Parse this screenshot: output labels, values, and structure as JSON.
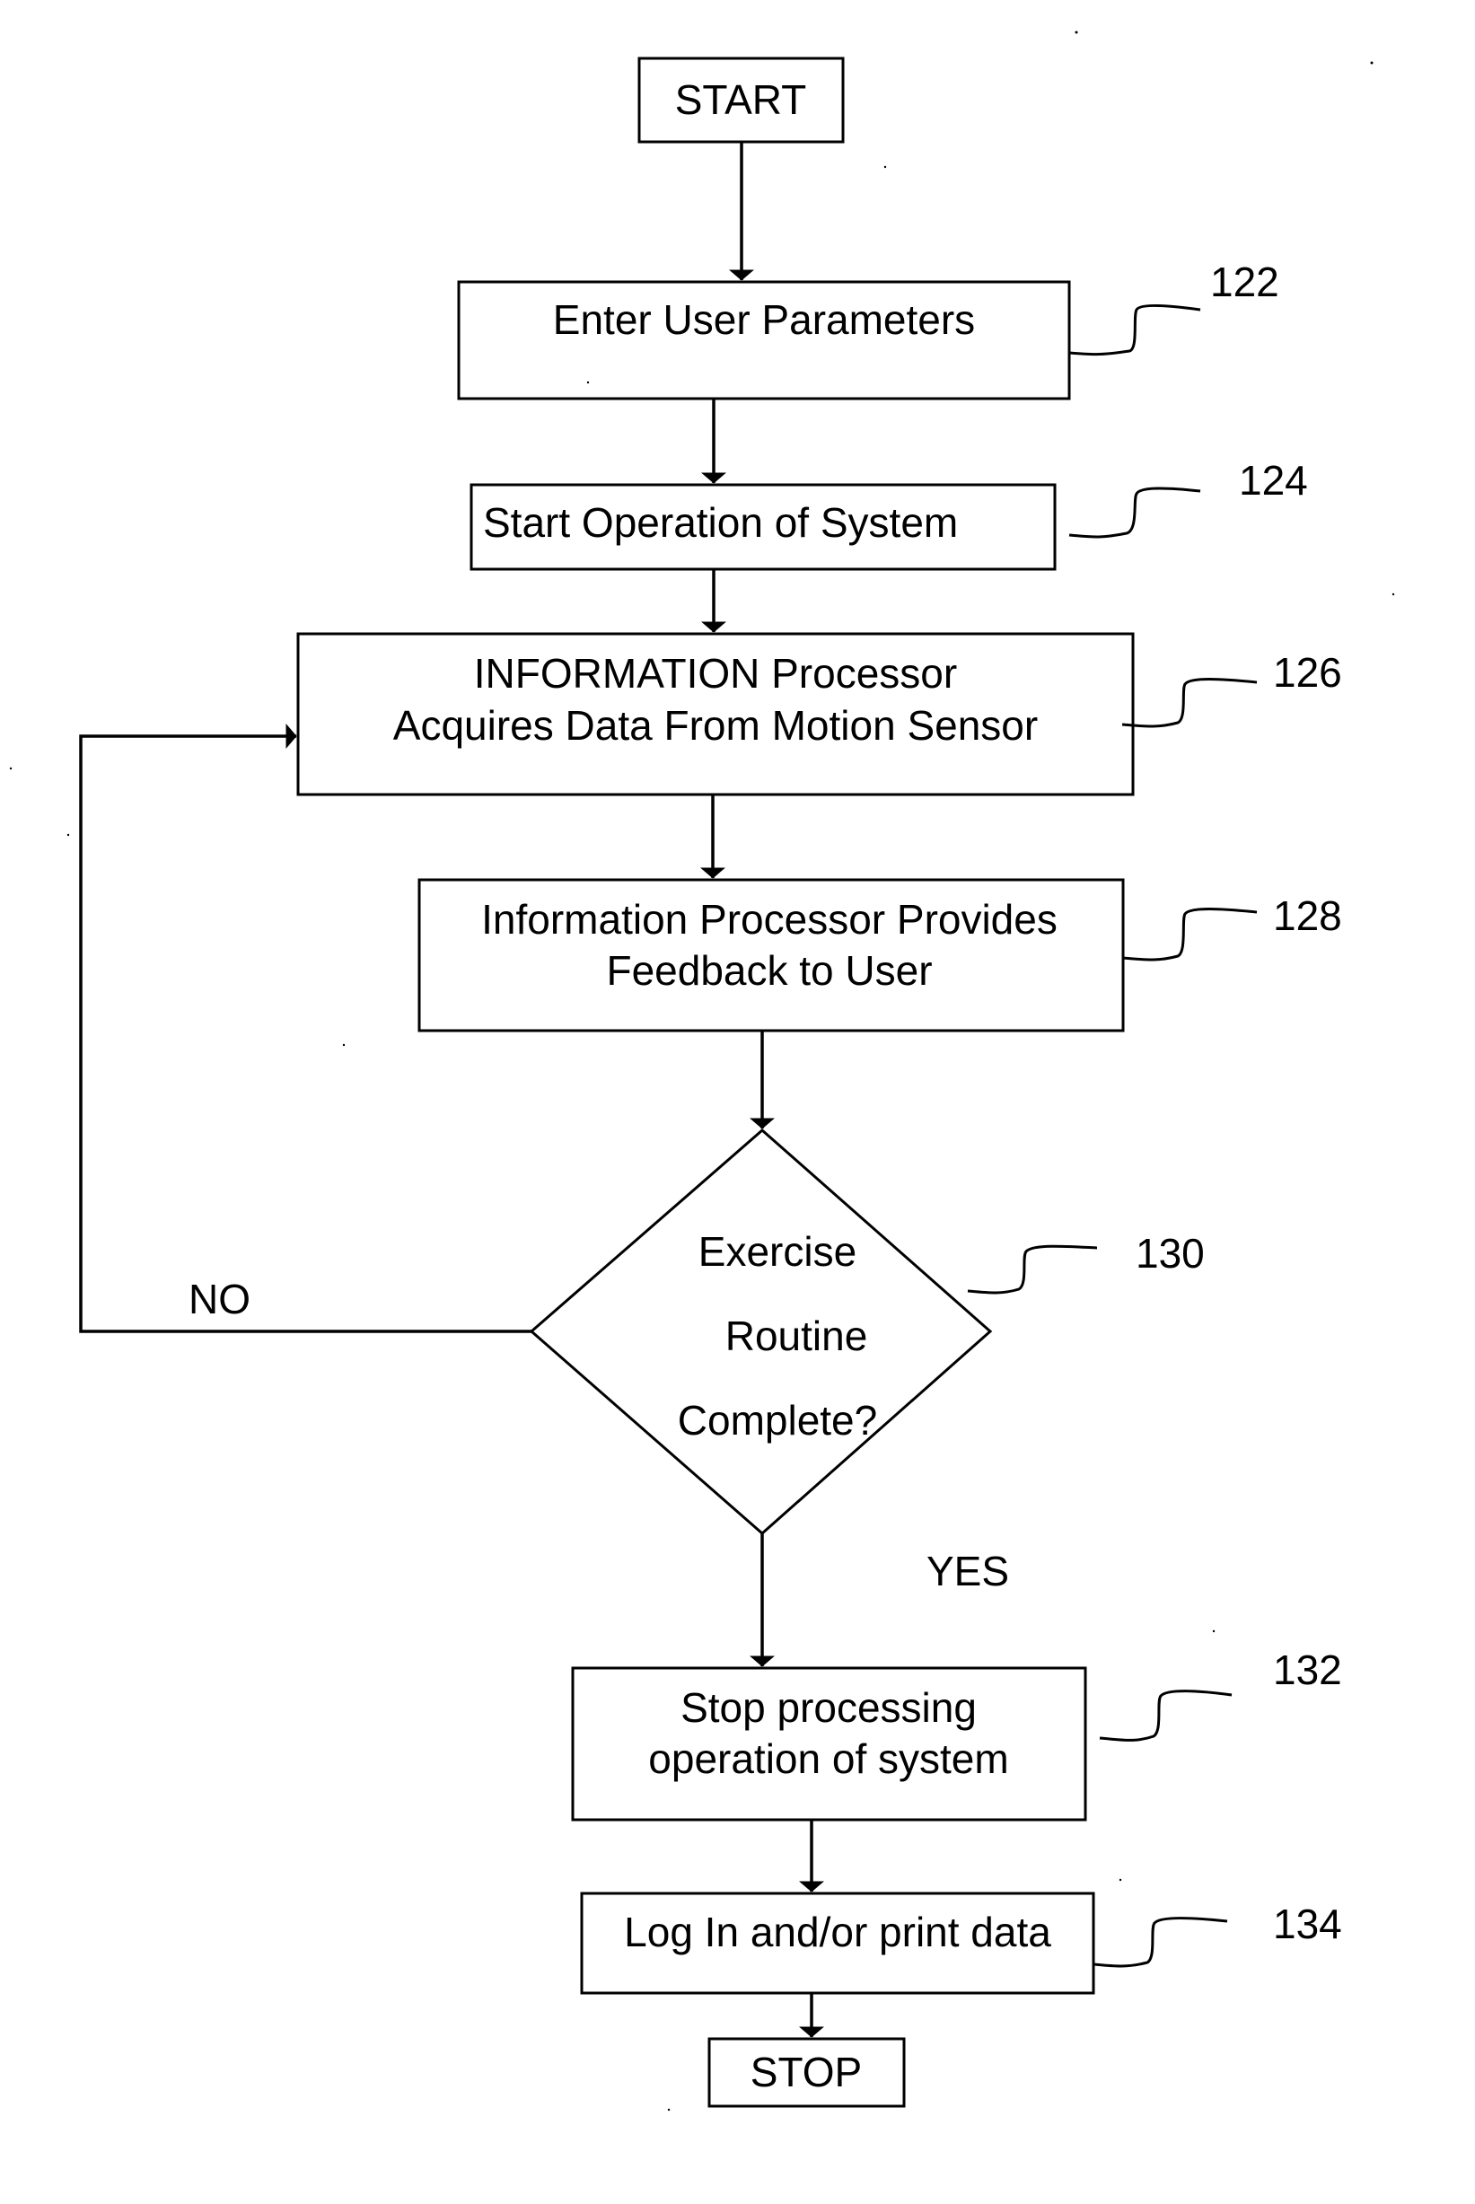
{
  "diagram": {
    "type": "flowchart",
    "nodes": {
      "start": {
        "label": "START"
      },
      "n122": {
        "ref": "122",
        "lines": [
          "Enter User Parameters"
        ]
      },
      "n124": {
        "ref": "124",
        "lines": [
          "Start Operation of System"
        ]
      },
      "n126": {
        "ref": "126",
        "lines": [
          "INFORMATION Processor",
          "Acquires Data From Motion Sensor"
        ]
      },
      "n128": {
        "ref": "128",
        "lines": [
          "Information Processor Provides",
          "Feedback to User"
        ]
      },
      "n130": {
        "ref": "130",
        "lines": [
          "Exercise",
          "Routine",
          "Complete?"
        ]
      },
      "n132": {
        "ref": "132",
        "lines": [
          "Stop processing",
          "operation of system"
        ]
      },
      "n134": {
        "ref": "134",
        "lines": [
          "Log In and/or print data"
        ]
      },
      "stop": {
        "label": "STOP"
      }
    },
    "edges": {
      "no_label": "NO",
      "yes_label": "YES"
    }
  }
}
